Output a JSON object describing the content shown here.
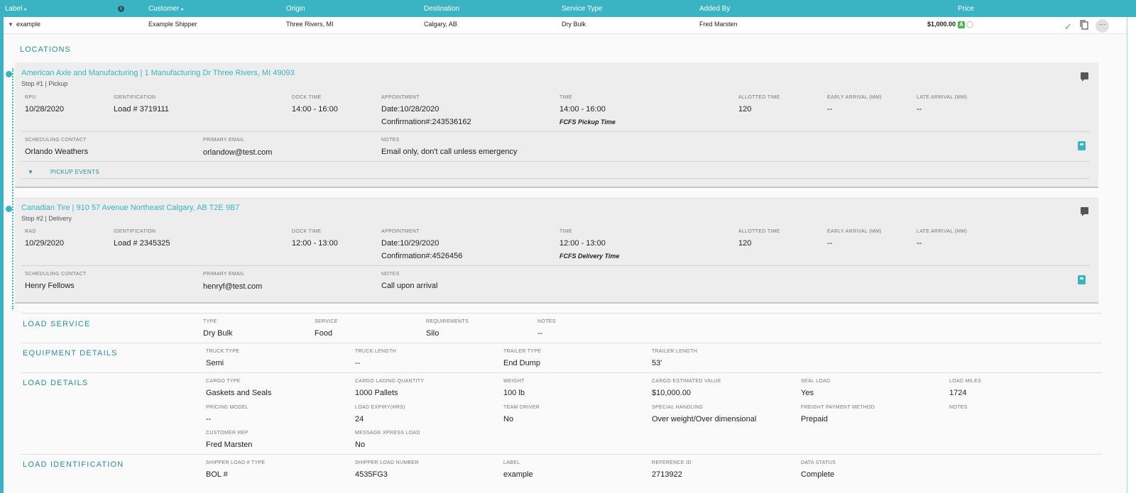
{
  "header": {
    "label": "Label",
    "customer": "Customer",
    "origin": "Origin",
    "destination": "Destination",
    "service_type": "Service Type",
    "added_by": "Added By",
    "price": "Price"
  },
  "summary": {
    "label": "example",
    "customer": "Example Shipper",
    "origin": "Three Rivers, MI",
    "destination": "Calgary, AB",
    "service_type": "Dry Bulk",
    "added_by": "Fred Marsten",
    "price": "$1,000.00",
    "badge": "A"
  },
  "locations": {
    "title": "LOCATIONS",
    "labels": {
      "identification": "IDENTIFICATION",
      "dock_time": "DOCK TIME",
      "appointment": "APPOINTMENT",
      "time": "TIME",
      "allotted_time": "ALLOTTED TIME",
      "early_arrival": "EARLY ARRIVAL (MM)",
      "late_arrival": "LATE ARRIVAL (MM)",
      "scheduling_contact": "SCHEDULING CONTACT",
      "primary_email": "PRIMARY EMAIL",
      "notes": "NOTES"
    },
    "stops": [
      {
        "title": "American Axle and Manufacturing |  1 Manufacturing Dr  Three Rivers,  MI  49093",
        "sub": "Stop #1 | Pickup",
        "date_label": "RPU",
        "date": "10/28/2020",
        "identification": "Load #  3719111",
        "dock_time": "14:00 - 16:00",
        "appointment_date": "Date:10/28/2020",
        "confirmation": "Confirmation#:243536162",
        "time": "14:00 - 16:00",
        "time_note": "FCFS Pickup Time",
        "allotted_time": "120",
        "early_arrival": "--",
        "late_arrival": "--",
        "scheduling_contact": "Orlando Weathers",
        "primary_email": "orlandow@test.com",
        "notes": "Email only, don't call unless emergency",
        "events_label": "PICKUP EVENTS"
      },
      {
        "title": "Canadian Tire |  910 57 Avenue Northeast  Calgary,  AB  T2E 9B7",
        "sub": "Stop #2 | Delivery",
        "date_label": "RAD",
        "date": "10/29/2020",
        "identification": "Load #  2345325",
        "dock_time": "12:00 - 13:00",
        "appointment_date": "Date:10/29/2020",
        "confirmation": "Confirmation#:4526456",
        "time": "12:00 - 13:00",
        "time_note": "FCFS Delivery Time",
        "allotted_time": "120",
        "early_arrival": "--",
        "late_arrival": "--",
        "scheduling_contact": "Henry Fellows",
        "primary_email": "henryf@test.com",
        "notes": "Call upon arrival"
      }
    ]
  },
  "load_service": {
    "title": "LOAD SERVICE",
    "type_label": "TYPE",
    "type": "Dry Bulk",
    "service_label": "SERVICE",
    "service": "Food",
    "requirements_label": "REQUIREMENTS",
    "requirements": "Silo",
    "notes_label": "NOTES",
    "notes": "--"
  },
  "equipment": {
    "title": "EQUIPMENT DETAILS",
    "truck_type_label": "TRUCK TYPE",
    "truck_type": "Semi",
    "truck_length_label": "TRUCK LENGTH",
    "truck_length": "--",
    "trailer_type_label": "TRAILER TYPE",
    "trailer_type": "End Dump",
    "trailer_length_label": "TRAILER LENGTH",
    "trailer_length": "53'"
  },
  "load_details": {
    "title": "LOAD DETAILS",
    "cargo_type_label": "CARGO TYPE",
    "cargo_type": "Gaskets and Seals",
    "lading_qty_label": "CARGO LADING QUANTITY",
    "lading_qty": "1000 Pallets",
    "weight_label": "WEIGHT",
    "weight": "100 lb",
    "est_value_label": "CARGO ESTIMATED VALUE",
    "est_value": "$10,000.00",
    "seal_load_label": "SEAL LOAD",
    "seal_load": "Yes",
    "load_miles_label": "LOAD MILES",
    "load_miles": "1724",
    "pricing_model_label": "PRICING MODEL",
    "pricing_model": "--",
    "load_expiry_label": "LOAD EXPIRY(HRS)",
    "load_expiry": "24",
    "team_driver_label": "TEAM DRIVER",
    "team_driver": "No",
    "special_handling_label": "SPECIAL HANDLING",
    "special_handling": "Over weight/Over dimensional",
    "freight_payment_label": "FREIGHT PAYMENT METHOD",
    "freight_payment": "Prepaid",
    "notes_label": "NOTES",
    "customer_rep_label": "CUSTOMER REP",
    "customer_rep": "Fred Marsten",
    "message_xpress_label": "MESSAGE XPRESS LOAD",
    "message_xpress": "No"
  },
  "load_identification": {
    "title": "LOAD IDENTIFICATION",
    "shipper_type_label": "SHIPPER LOAD # TYPE",
    "shipper_type": "BOL #",
    "shipper_number_label": "SHIPPER LOAD NUMBER",
    "shipper_number": "4535FG3",
    "label_label": "LABEL",
    "label": "example",
    "reference_label": "REFERENCE ID",
    "reference": "2713922",
    "data_status_label": "DATA STATUS",
    "data_status": "Complete"
  }
}
